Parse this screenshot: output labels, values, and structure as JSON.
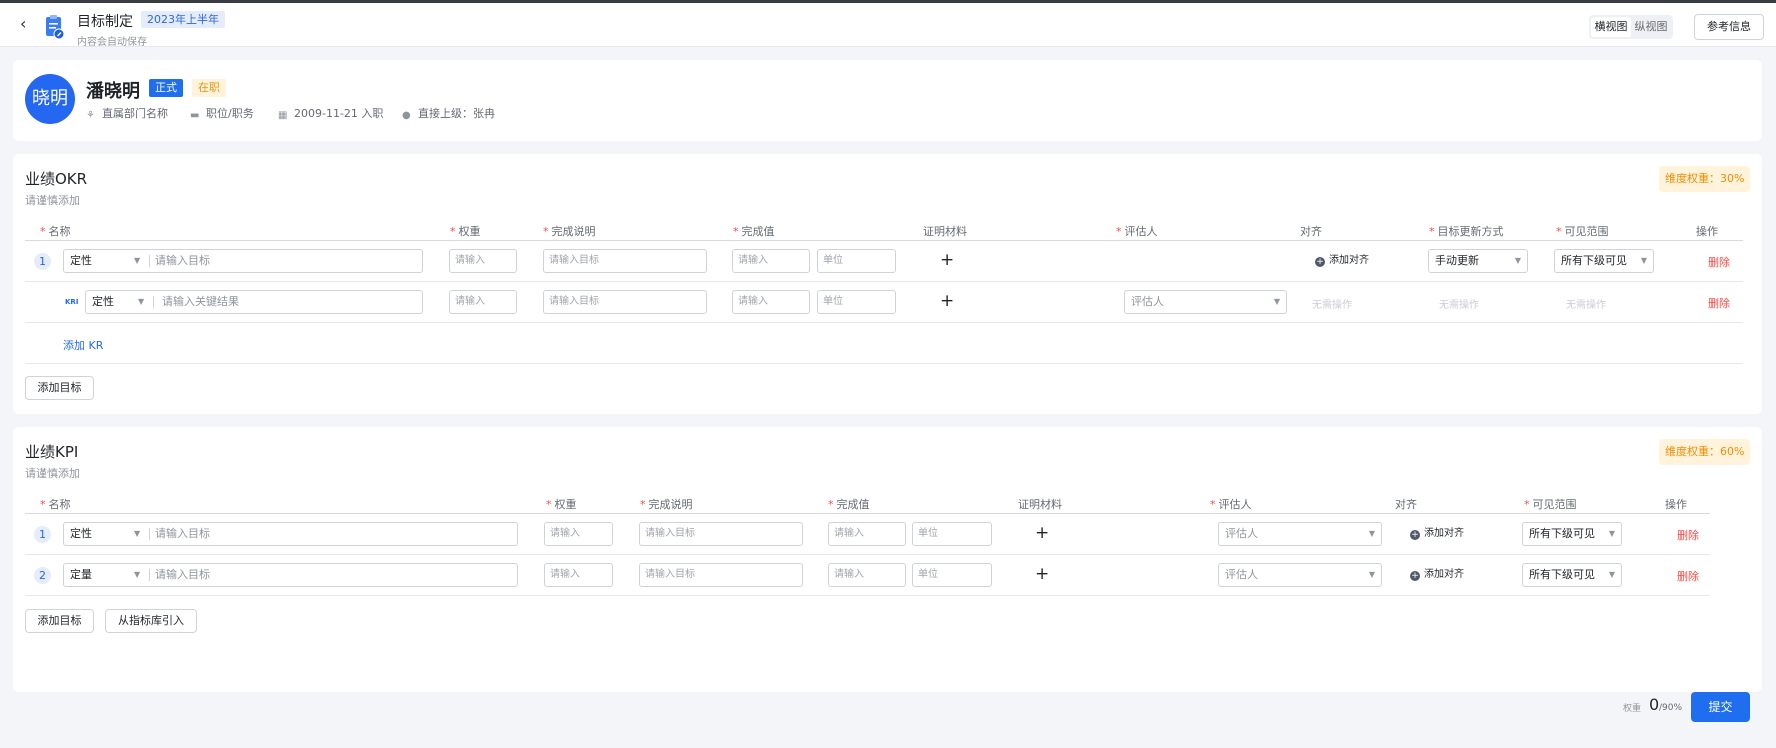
{
  "header": {
    "title": "目标制定",
    "period_tag": "2023年上半年",
    "autosave_note": "内容会自动保存",
    "view_horizontal": "横视图",
    "view_vertical": "纵视图",
    "reference_button": "参考信息"
  },
  "profile": {
    "avatar_text": "晓明",
    "name": "潘晓明",
    "tag_formal": "正式",
    "tag_active": "在职",
    "department": "直属部门名称",
    "position": "职位/职务",
    "join_date": "2009-11-21 入职",
    "manager": "直接上级：张冉"
  },
  "okr": {
    "title": "业绩OKR",
    "subtitle": "请谨慎添加",
    "weight_tag": "维度权重：30%",
    "headers": {
      "name": "名称",
      "weight": "权重",
      "completion_desc": "完成说明",
      "completion_value": "完成值",
      "evidence": "证明材料",
      "evaluator": "评估人",
      "alignment": "对齐",
      "update_method": "目标更新方式",
      "visibility": "可见范围",
      "actions": "操作"
    },
    "objective": {
      "index": "1",
      "type": "定性",
      "name_placeholder": "请输入目标",
      "weight_placeholder": "请输入",
      "desc_placeholder": "请输入目标",
      "value_placeholder": "请输入",
      "unit_placeholder": "单位",
      "align_label": "添加对齐",
      "update_method": "手动更新",
      "visibility": "所有下级可见",
      "delete_label": "删除"
    },
    "key_result": {
      "badge": "KRI",
      "type": "定性",
      "name_placeholder": "请输入关键结果",
      "weight_placeholder": "请输入",
      "desc_placeholder": "请输入目标",
      "value_placeholder": "请输入",
      "unit_placeholder": "单位",
      "evaluator_placeholder": "评估人",
      "no_action_1": "无需操作",
      "no_action_2": "无需操作",
      "no_action_3": "无需操作",
      "delete_label": "删除"
    },
    "add_kr": "添加 KR",
    "add_objective": "添加目标"
  },
  "kpi": {
    "title": "业绩KPI",
    "subtitle": "请谨慎添加",
    "weight_tag": "维度权重：60%",
    "headers": {
      "name": "名称",
      "weight": "权重",
      "completion_desc": "完成说明",
      "completion_value": "完成值",
      "evidence": "证明材料",
      "evaluator": "评估人",
      "alignment": "对齐",
      "visibility": "可见范围",
      "actions": "操作"
    },
    "rows": [
      {
        "index": "1",
        "type": "定性",
        "name_placeholder": "请输入目标",
        "weight_placeholder": "请输入",
        "desc_placeholder": "请输入目标",
        "value_placeholder": "请输入",
        "unit_placeholder": "单位",
        "evaluator_placeholder": "评估人",
        "align_label": "添加对齐",
        "visibility": "所有下级可见",
        "delete_label": "删除"
      },
      {
        "index": "2",
        "type": "定量",
        "name_placeholder": "请输入目标",
        "weight_placeholder": "请输入",
        "desc_placeholder": "请输入目标",
        "value_placeholder": "请输入",
        "unit_placeholder": "单位",
        "evaluator_placeholder": "评估人",
        "align_label": "添加对齐",
        "visibility": "所有下级可见",
        "delete_label": "删除"
      }
    ],
    "add_objective": "添加目标",
    "import_button": "从指标库引入"
  },
  "footer": {
    "weight_label": "权重",
    "weight_value": "0",
    "weight_max": "/90%",
    "submit_label": "提交"
  },
  "colors": {
    "primary": "#1f6ef0",
    "danger": "#f54a45",
    "warning": "#f08c00"
  }
}
